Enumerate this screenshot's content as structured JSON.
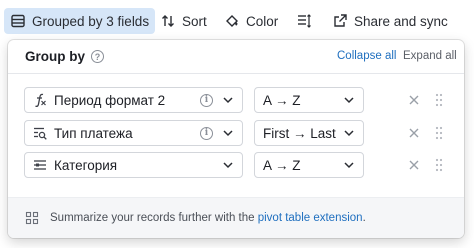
{
  "toolbar": {
    "grouped_label": "Grouped by 3 fields",
    "sort_label": "Sort",
    "color_label": "Color",
    "share_label": "Share and sync"
  },
  "group_panel": {
    "title": "Group by",
    "collapse_all": "Collapse all",
    "expand_all": "Expand all",
    "rows": [
      {
        "field": "Период формат 2",
        "field_icon": "formula-icon",
        "has_info": true,
        "order": "A → Z"
      },
      {
        "field": "Тип платежа",
        "field_icon": "lookup-icon",
        "has_info": true,
        "order": "First → Last"
      },
      {
        "field": "Категория",
        "field_icon": "single-select-icon",
        "has_info": false,
        "order": "A → Z"
      }
    ],
    "footer": {
      "text_before": "Summarize your records further with the ",
      "link": "pivot table extension",
      "text_after": "."
    }
  },
  "colors": {
    "accent_bg": "#d6e6f8",
    "link": "#1f6fbf"
  }
}
